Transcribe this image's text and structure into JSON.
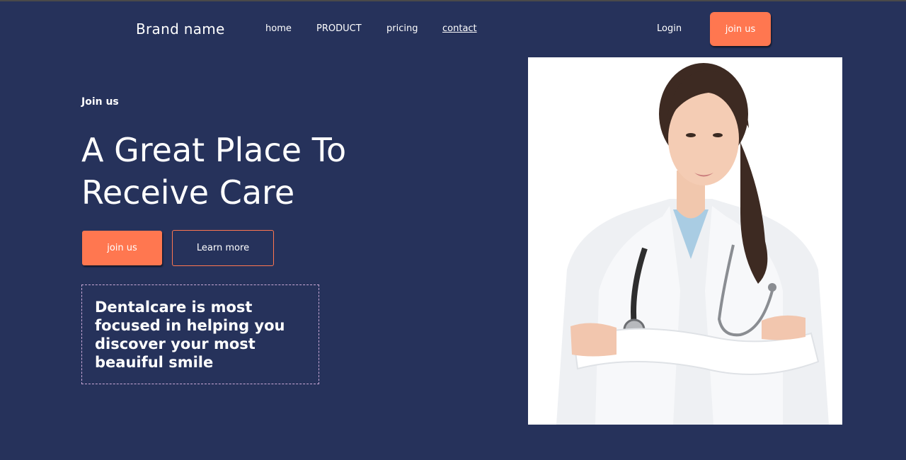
{
  "header": {
    "brand": "Brand name",
    "nav": [
      "home",
      "PRODUCT",
      "pricing",
      "contact"
    ],
    "login_label": "Login",
    "join_label": "join us"
  },
  "hero": {
    "eyebrow": "Join us",
    "headline_line1": "A Great Place To",
    "headline_line2": "Receive Care",
    "primary_button": "join us",
    "secondary_button": "Learn more",
    "tagline": "Dentalcare is most focused in helping you discover your most beauiful smile"
  },
  "colors": {
    "background": "#26325b",
    "accent": "#ff7750",
    "dashed_border": "#c9a8d6"
  },
  "image": {
    "subject": "doctor-portrait"
  }
}
